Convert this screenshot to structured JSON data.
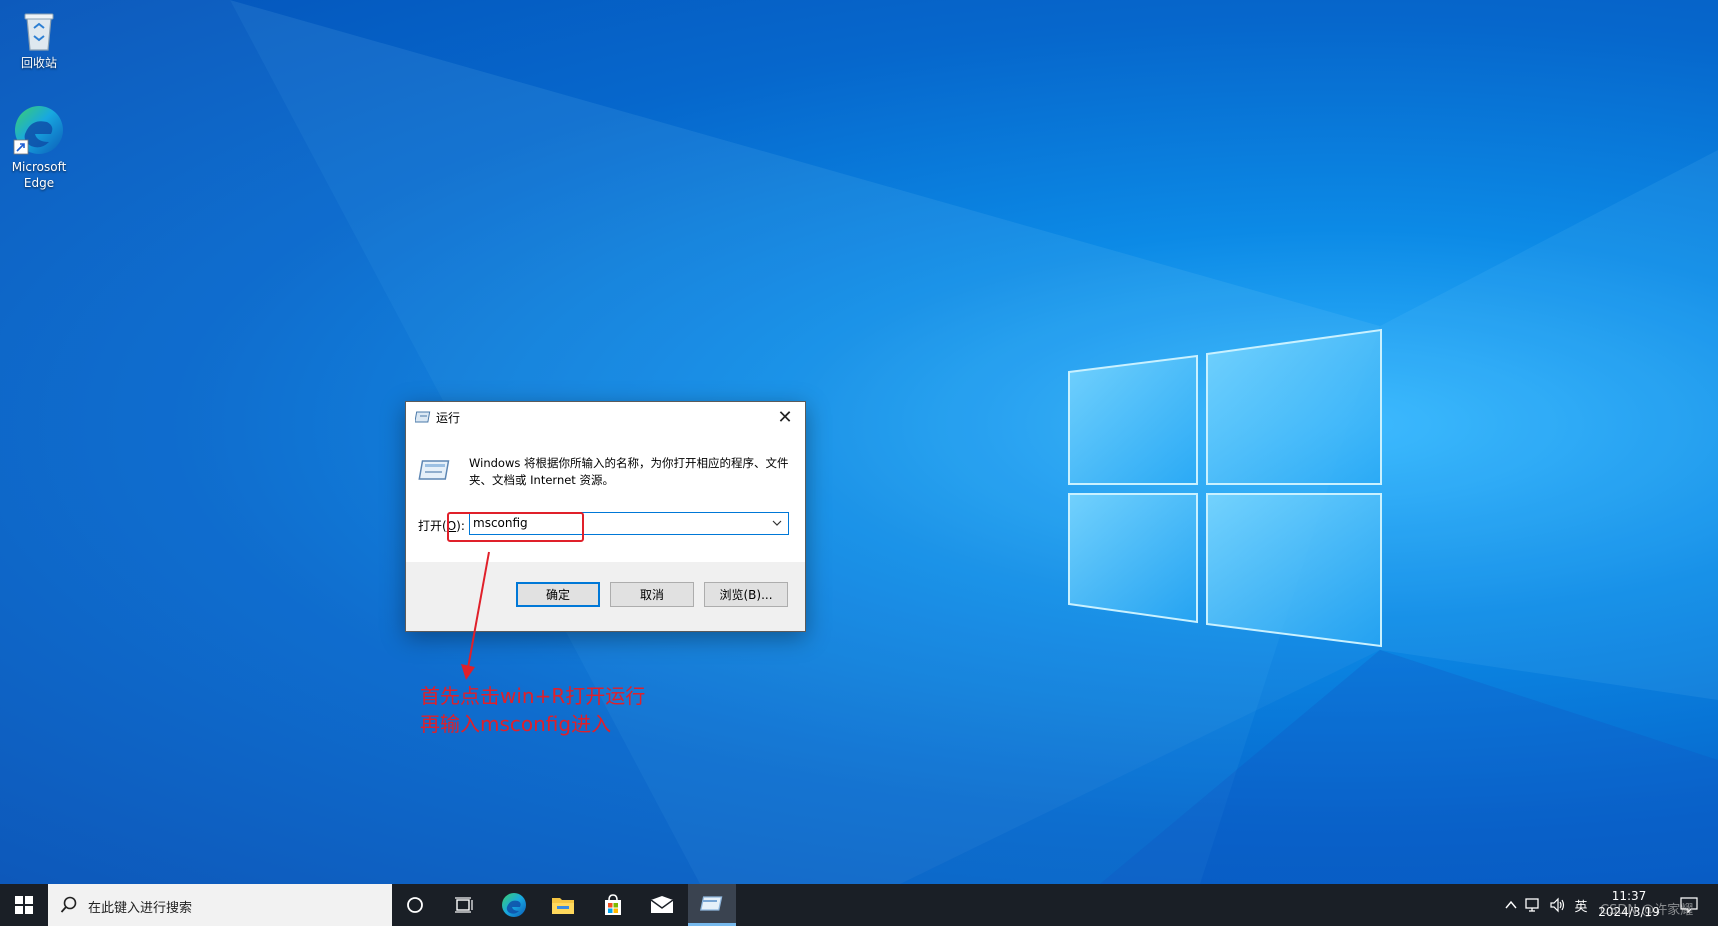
{
  "desktop": {
    "icons": [
      {
        "label": "回收站",
        "icon": "recycle-bin-icon"
      },
      {
        "label": "Microsoft Edge",
        "icon": "edge-icon"
      }
    ]
  },
  "run_dialog": {
    "title": "运行",
    "description": "Windows 将根据你所输入的名称，为你打开相应的程序、文件夹、文档或 Internet 资源。",
    "open_label_prefix": "打开(",
    "open_label_accel": "O",
    "open_label_suffix": "):",
    "input_value": "msconfig",
    "ok_label": "确定",
    "cancel_label": "取消",
    "browse_label": "浏览(B)..."
  },
  "annotation": {
    "text": "首先点击win+R打开运行\n再输入msconfig进入",
    "color": "#e0202a"
  },
  "taskbar": {
    "search_placeholder": "在此键入进行搜索",
    "apps": [
      "cortana-icon",
      "task-view-icon",
      "edge-icon",
      "file-explorer-icon",
      "store-icon",
      "mail-icon",
      "run-icon"
    ],
    "ime": "英",
    "time": "11:37",
    "date": "2024/3/19"
  },
  "watermark": "CSDN @许家耀"
}
